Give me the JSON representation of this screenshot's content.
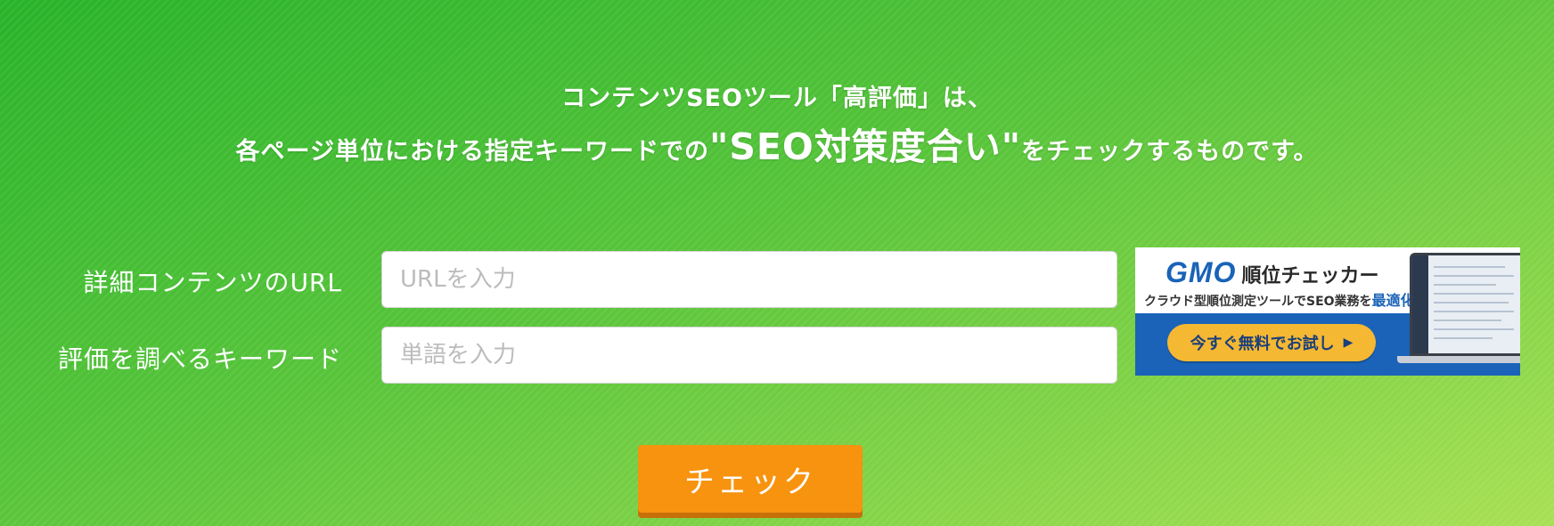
{
  "intro": {
    "line1": "コンテンツSEOツール「高評価」は、",
    "line2_before": "各ページ単位における指定キーワードでの",
    "line2_emphasis": "\"SEO対策度合い\"",
    "line2_after": "をチェックするものです。"
  },
  "form": {
    "url_label": "詳細コンテンツのURL",
    "url_placeholder": "URLを入力",
    "keyword_label": "評価を調べるキーワード",
    "keyword_placeholder": "単語を入力",
    "submit_label": "チェック"
  },
  "ad": {
    "brand": "GMO",
    "product": "順位チェッカー",
    "tagline_before": "クラウド型順位測定ツールでSEO業務を",
    "tagline_accent": "最適化!",
    "cta_label": "今すぐ無料でお試し",
    "cta_icon": "play-triangle-icon",
    "colors": {
      "brand_blue": "#1a63b8",
      "cta_yellow": "#f5b833"
    }
  },
  "colors": {
    "background_start": "#28b32a",
    "background_end": "#a8e055",
    "button_orange": "#f7930f"
  }
}
